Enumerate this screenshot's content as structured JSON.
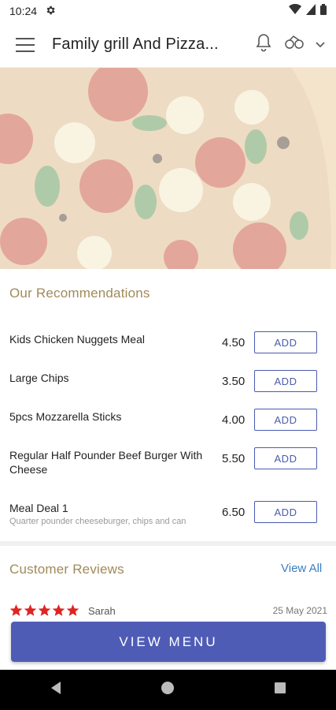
{
  "status_bar": {
    "time": "10:24"
  },
  "app_bar": {
    "title": "Family grill And Pizza..."
  },
  "recommendations": {
    "title": "Our Recommendations",
    "items": [
      {
        "name": "Kids Chicken Nuggets Meal",
        "price": "4.50",
        "button": "ADD",
        "description": ""
      },
      {
        "name": "Large Chips",
        "price": "3.50",
        "button": "ADD",
        "description": ""
      },
      {
        "name": "5pcs Mozzarella Sticks",
        "price": "4.00",
        "button": "ADD",
        "description": ""
      },
      {
        "name": "Regular Half Pounder Beef Burger With Cheese",
        "price": "5.50",
        "button": "ADD",
        "description": ""
      },
      {
        "name": "Meal Deal 1",
        "price": "6.50",
        "button": "ADD",
        "description": "Quarter pounder cheeseburger, chips and can"
      }
    ]
  },
  "reviews": {
    "title": "Customer Reviews",
    "view_all": "View All",
    "first": {
      "rating": 5,
      "name": "Sarah",
      "date": "25 May 2021"
    }
  },
  "cta": {
    "label": "VIEW MENU"
  },
  "colors": {
    "accent": "#4f5cb6",
    "section_title": "#a08a5a",
    "link": "#3a7fc0",
    "star": "#e02424"
  }
}
